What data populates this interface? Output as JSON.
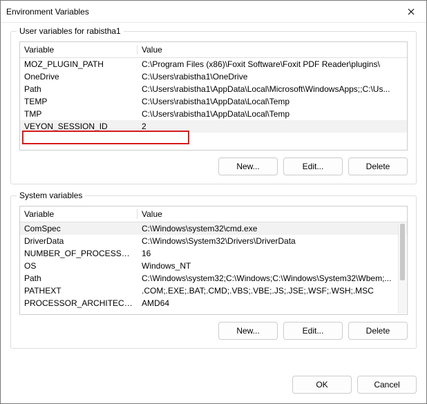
{
  "window": {
    "title": "Environment Variables"
  },
  "userSection": {
    "label": "User variables for rabistha1",
    "headers": {
      "variable": "Variable",
      "value": "Value"
    },
    "rows": [
      {
        "name": "MOZ_PLUGIN_PATH",
        "value": "C:\\Program Files (x86)\\Foxit Software\\Foxit PDF Reader\\plugins\\"
      },
      {
        "name": "OneDrive",
        "value": "C:\\Users\\rabistha1\\OneDrive"
      },
      {
        "name": "Path",
        "value": "C:\\Users\\rabistha1\\AppData\\Local\\Microsoft\\WindowsApps;;C:\\Us..."
      },
      {
        "name": "TEMP",
        "value": "C:\\Users\\rabistha1\\AppData\\Local\\Temp"
      },
      {
        "name": "TMP",
        "value": "C:\\Users\\rabistha1\\AppData\\Local\\Temp"
      },
      {
        "name": "VEYON_SESSION_ID",
        "value": "2"
      }
    ],
    "buttons": {
      "new": "New...",
      "edit": "Edit...",
      "delete": "Delete"
    }
  },
  "systemSection": {
    "label": "System variables",
    "headers": {
      "variable": "Variable",
      "value": "Value"
    },
    "rows": [
      {
        "name": "ComSpec",
        "value": "C:\\Windows\\system32\\cmd.exe"
      },
      {
        "name": "DriverData",
        "value": "C:\\Windows\\System32\\Drivers\\DriverData"
      },
      {
        "name": "NUMBER_OF_PROCESSORS",
        "value": "16"
      },
      {
        "name": "OS",
        "value": "Windows_NT"
      },
      {
        "name": "Path",
        "value": "C:\\Windows\\system32;C:\\Windows;C:\\Windows\\System32\\Wbem;..."
      },
      {
        "name": "PATHEXT",
        "value": ".COM;.EXE;.BAT;.CMD;.VBS;.VBE;.JS;.JSE;.WSF;.WSH;.MSC"
      },
      {
        "name": "PROCESSOR_ARCHITECTURE",
        "value": "AMD64"
      }
    ],
    "buttons": {
      "new": "New...",
      "edit": "Edit...",
      "delete": "Delete"
    }
  },
  "footer": {
    "ok": "OK",
    "cancel": "Cancel"
  }
}
